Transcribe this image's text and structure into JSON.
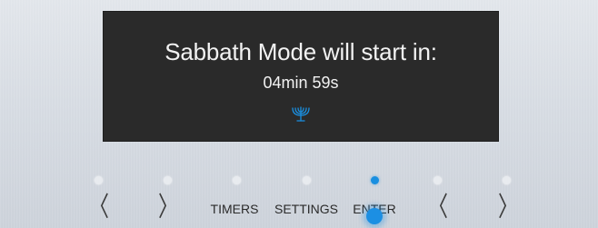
{
  "display": {
    "message": "Sabbath Mode will start in:",
    "countdown": "04min 59s",
    "icon": "menorah-icon",
    "icon_color": "#1a8fe0"
  },
  "controls": {
    "left_prev": "〈",
    "left_next": "〉",
    "timers_label": "TIMERS",
    "settings_label": "SETTINGS",
    "enter_label": "ENTER",
    "right_prev": "〈",
    "right_next": "〉",
    "active_indicator": "enter",
    "accent_color": "#1a8fe0"
  }
}
